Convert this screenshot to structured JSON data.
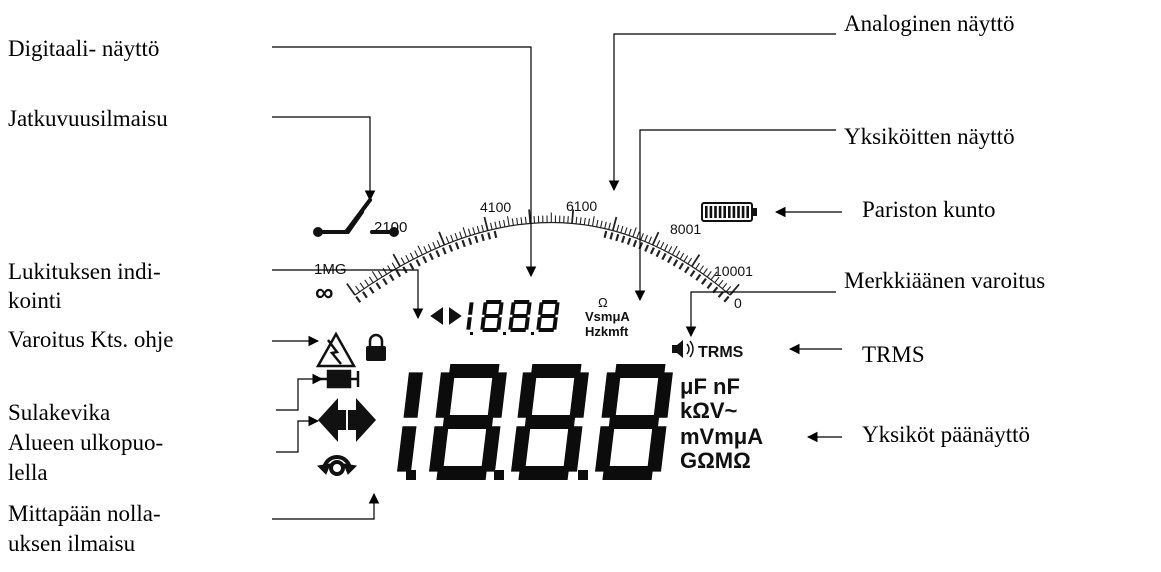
{
  "labels": {
    "digital_display": "Digitaali- näyttö",
    "continuity": "Jatkuvuusilmaisu",
    "lock_line1": "Lukituksen indi-",
    "lock_line2": "kointi",
    "warning_manual": "Varoitus Kts. ohje",
    "fuse_line1": "Sulakevika",
    "range_line1": "Alueen ulkopuo-",
    "range_line2": "lella",
    "nulling_line1": "Mittapään nolla-",
    "nulling_line2": "uksen ilmaisu",
    "analog_display": "Analoginen näyttö",
    "units_display": "Yksiköitten näyttö",
    "battery": "Pariston kunto",
    "beeper": "Merkkiäänen varoitus",
    "trms": "TRMS",
    "main_units": "Yksiköt päänäyttö"
  },
  "lcd": {
    "scale_2100": "2100",
    "scale_4100": "4100",
    "scale_6100": "6100",
    "scale_8001": "8001",
    "scale_1mg": "1MG",
    "scale_10001": "10001",
    "scale_inf": "∞",
    "scale_zero": "0",
    "small_unit_ohm": "Ω",
    "small_unit_vsmua": "VsmμA",
    "small_unit_hzkmft": "Hzkmft",
    "trms_text": "TRMS",
    "unit_row1": "μF nF",
    "unit_row2": "kΩV~",
    "unit_row3": "mVmμA",
    "unit_row4": "GΩMΩ"
  }
}
